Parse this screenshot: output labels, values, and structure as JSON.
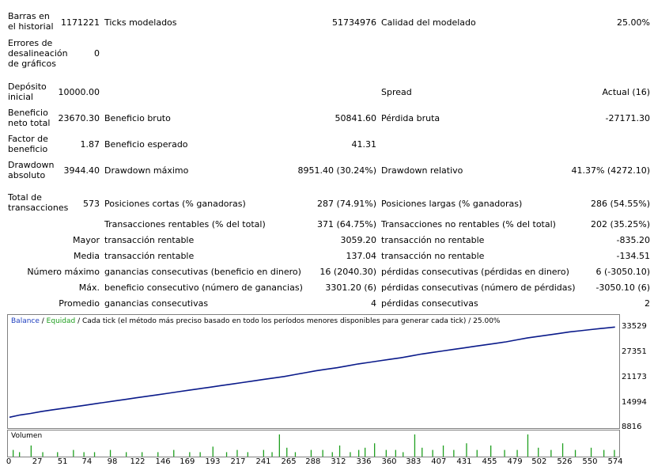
{
  "report": {
    "bars_label": "Barras en el historial",
    "bars_value": "1171221",
    "ticks_label": "Ticks modelados",
    "ticks_value": "51734976",
    "quality_label": "Calidad del modelado",
    "quality_value": "25.00%",
    "errors_label": "Errores de desalineación de gráficos",
    "errors_value": "0",
    "deposit_label": "Depósito inicial",
    "deposit_value": "10000.00",
    "spread_label": "Spread",
    "spread_value": "Actual (16)",
    "net_label": "Beneficio neto total",
    "net_value": "23670.30",
    "gross_profit_label": "Beneficio bruto",
    "gross_profit_value": "50841.60",
    "gross_loss_label": "Pérdida bruta",
    "gross_loss_value": "-27171.30",
    "pf_label": "Factor de beneficio",
    "pf_value": "1.87",
    "expected_label": "Beneficio esperado",
    "expected_value": "41.31",
    "dd_abs_label": "Drawdown absoluto",
    "dd_abs_value": "3944.40",
    "dd_max_label": "Drawdown máximo",
    "dd_max_value": "8951.40 (30.24%)",
    "dd_rel_label": "Drawdown relativo",
    "dd_rel_value": "41.37% (4272.10)",
    "trades_label": "Total de transacciones",
    "trades_value": "573",
    "short_label": "Posiciones cortas (% ganadoras)",
    "short_value": "287 (74.91%)",
    "long_label": "Posiciones largas (% ganadoras)",
    "long_value": "286 (54.55%)",
    "profit_trades_label": "Transacciones rentables (% del total)",
    "profit_trades_value": "371 (64.75%)",
    "loss_trades_label": "Transacciones no rentables (% del total)",
    "loss_trades_value": "202 (35.25%)",
    "largest_prefix": "Mayor",
    "largest_profit_label": "transacción rentable",
    "largest_profit_value": "3059.20",
    "largest_loss_label": "transacción no rentable",
    "largest_loss_value": "-835.20",
    "average_prefix": "Media",
    "average_profit_label": "transacción rentable",
    "average_profit_value": "137.04",
    "average_loss_label": "transacción no rentable",
    "average_loss_value": "-134.51",
    "maxcount_prefix": "Número máximo",
    "max_consec_wins_label": "ganancias consecutivas (beneficio en dinero)",
    "max_consec_wins_value": "16 (2040.30)",
    "max_consec_losses_label": "pérdidas consecutivas (pérdidas en dinero)",
    "max_consec_losses_value": "6 (-3050.10)",
    "maxamt_prefix": "Máx.",
    "max_consec_profit_label": "beneficio consecutivo (número de ganancias)",
    "max_consec_profit_value": "3301.20 (6)",
    "max_consec_loss_label": "pérdidas consecutivas (número de pérdidas)",
    "max_consec_loss_value": "-3050.10 (6)",
    "avgcons_prefix": "Promedio",
    "avg_consec_wins_label": "ganancias consecutivas",
    "avg_consec_wins_value": "4",
    "avg_consec_losses_label": "pérdidas consecutivas",
    "avg_consec_losses_value": "2"
  },
  "chart": {
    "legend_balance": "Balance",
    "legend_sep": " / ",
    "legend_equity": "Equidad",
    "legend_rest": " / Cada tick (el método más preciso basado en todo los períodos menores disponibles para generar cada tick)  / 25.00%",
    "volume_label": "Volumen",
    "balance_color": "#1f3fbf",
    "equity_color": "#1f9f1f",
    "y_ticks": [
      "33529",
      "27351",
      "21173",
      "14994",
      "8816"
    ],
    "x_ticks": [
      "0",
      "27",
      "51",
      "74",
      "98",
      "122",
      "146",
      "169",
      "193",
      "217",
      "241",
      "265",
      "288",
      "312",
      "336",
      "360",
      "383",
      "407",
      "431",
      "455",
      "479",
      "502",
      "526",
      "550",
      "574"
    ]
  },
  "chart_data": {
    "type": "line",
    "x": [
      0,
      10,
      20,
      30,
      40,
      50,
      60,
      70,
      80,
      90,
      100,
      110,
      120,
      130,
      140,
      150,
      160,
      170,
      180,
      190,
      200,
      210,
      220,
      230,
      240,
      250,
      260,
      270,
      280,
      290,
      300,
      310,
      320,
      330,
      340,
      350,
      360,
      370,
      380,
      390,
      400,
      410,
      420,
      430,
      440,
      450,
      460,
      470,
      480,
      490,
      500,
      510,
      520,
      530,
      540,
      550,
      560,
      573
    ],
    "series": [
      {
        "name": "Balance",
        "values": [
          10000,
          10600,
          11000,
          11500,
          11900,
          12300,
          12700,
          13100,
          13500,
          13900,
          14300,
          14700,
          15100,
          15500,
          15900,
          16300,
          16700,
          17100,
          17500,
          17900,
          18300,
          18700,
          19100,
          19500,
          19900,
          20300,
          20700,
          21200,
          21700,
          22200,
          22600,
          23000,
          23500,
          24000,
          24400,
          24800,
          25200,
          25600,
          26100,
          26600,
          27000,
          27400,
          27800,
          28200,
          28600,
          29000,
          29400,
          29800,
          30300,
          30800,
          31200,
          31600,
          32000,
          32400,
          32700,
          33000,
          33300,
          33670
        ]
      }
    ],
    "ylim": [
      8816,
      33529
    ],
    "xlim": [
      0,
      574
    ],
    "grid": false,
    "volume": {
      "x": [
        3,
        9,
        20,
        31,
        45,
        60,
        70,
        80,
        95,
        110,
        125,
        140,
        155,
        170,
        180,
        192,
        205,
        215,
        225,
        240,
        248,
        255,
        262,
        270,
        285,
        296,
        305,
        312,
        322,
        330,
        336,
        345,
        356,
        365,
        372,
        383,
        390,
        400,
        410,
        420,
        432,
        442,
        455,
        468,
        480,
        490,
        500,
        512,
        523,
        535,
        550,
        562,
        572
      ],
      "values": [
        0.3,
        0.2,
        0.5,
        0.2,
        0.2,
        0.3,
        0.2,
        0.2,
        0.3,
        0.2,
        0.2,
        0.2,
        0.3,
        0.2,
        0.2,
        0.45,
        0.2,
        0.3,
        0.2,
        0.3,
        0.2,
        1.0,
        0.4,
        0.2,
        0.3,
        0.3,
        0.2,
        0.5,
        0.2,
        0.3,
        0.4,
        0.6,
        0.3,
        0.3,
        0.2,
        1.0,
        0.4,
        0.3,
        0.5,
        0.3,
        0.6,
        0.3,
        0.5,
        0.3,
        0.3,
        1.0,
        0.4,
        0.3,
        0.6,
        0.3,
        0.4,
        0.3,
        0.3
      ]
    }
  }
}
